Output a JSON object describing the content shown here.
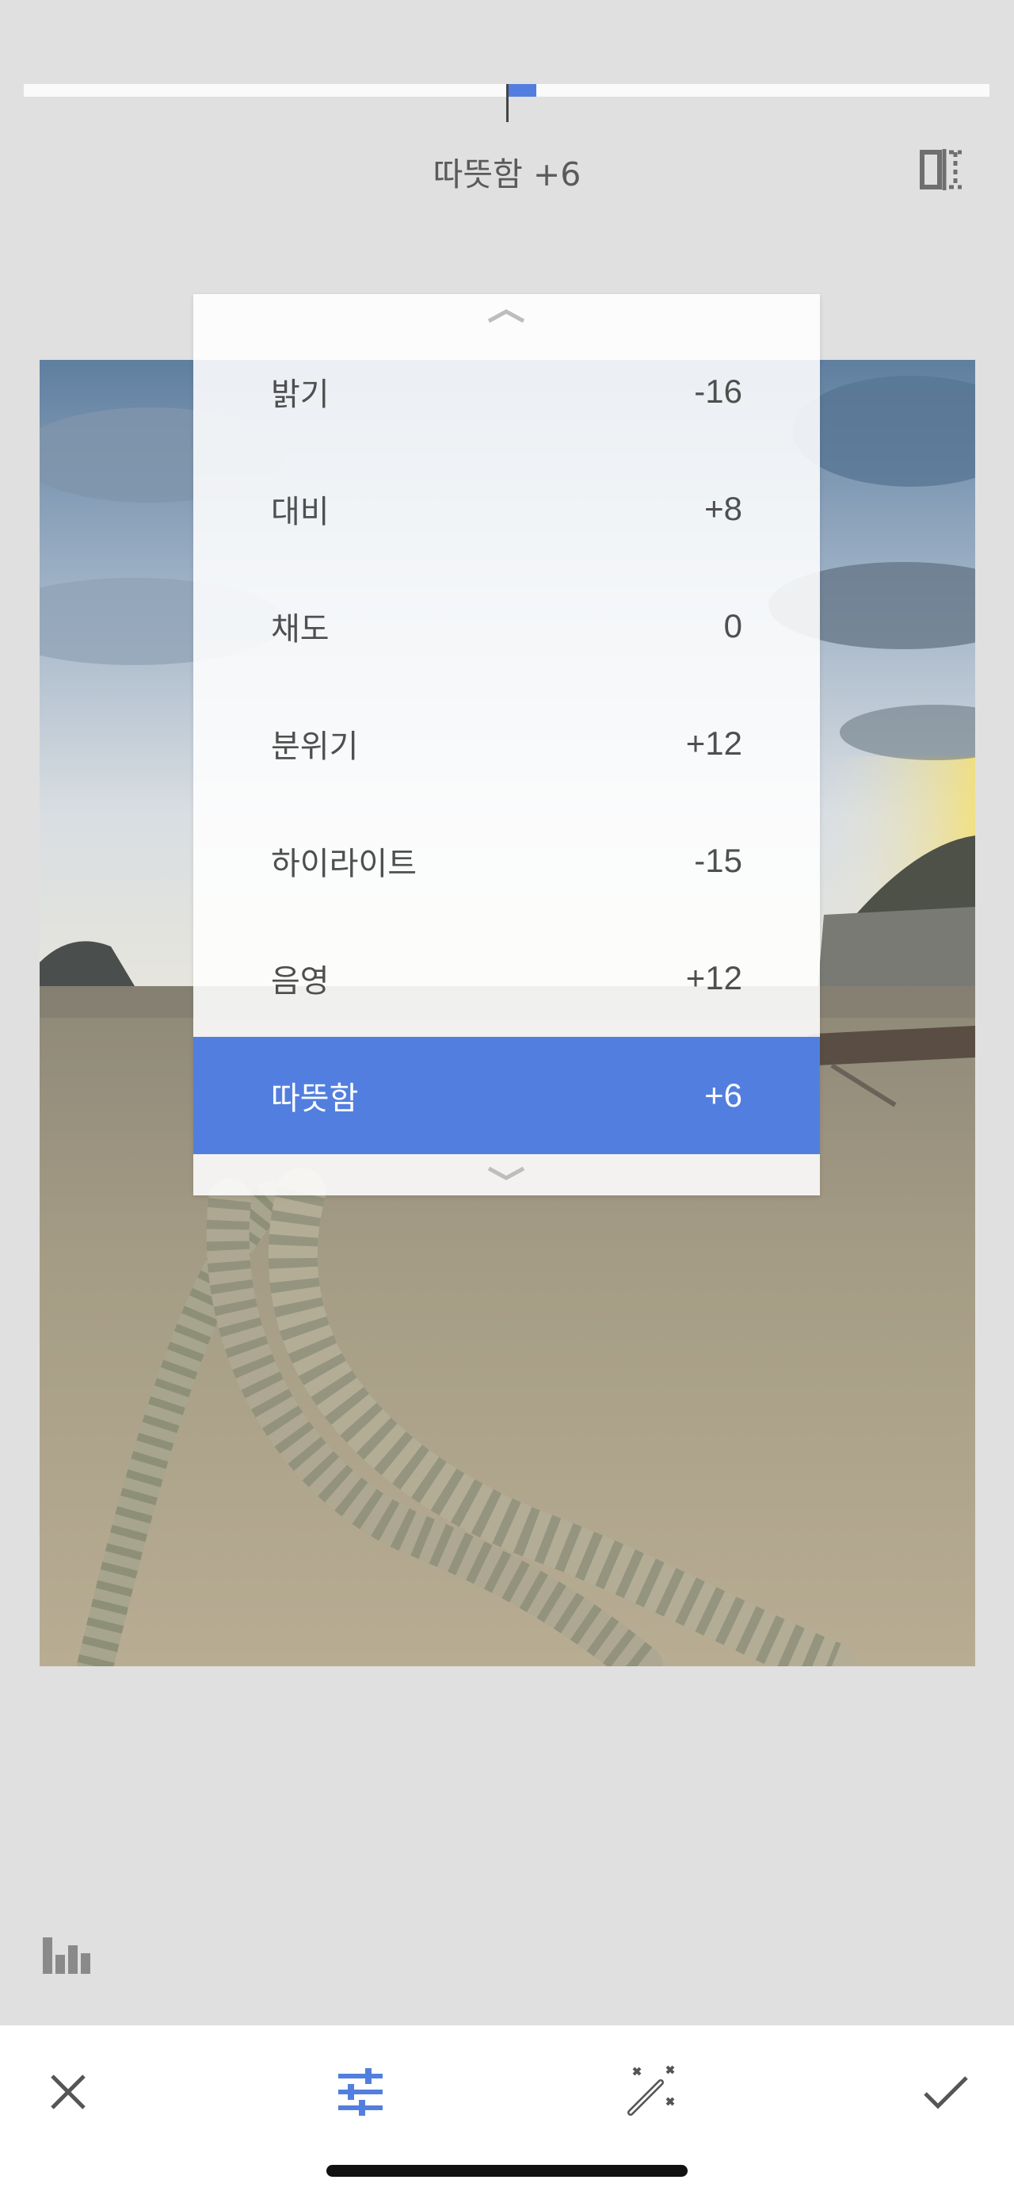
{
  "slider": {
    "value_label": "따뜻함 +6",
    "value": 6,
    "min": -100,
    "max": 100,
    "fill_color": "#527fdf"
  },
  "compare_icon": "compare-split-icon",
  "adjust_menu": {
    "items": [
      {
        "label": "밝기",
        "value": "-16"
      },
      {
        "label": "대비",
        "value": "+8"
      },
      {
        "label": "채도",
        "value": "0"
      },
      {
        "label": "분위기",
        "value": "+12"
      },
      {
        "label": "하이라이트",
        "value": "-15"
      },
      {
        "label": "음영",
        "value": "+12"
      },
      {
        "label": "따뜻함",
        "value": "+6",
        "selected": true
      }
    ],
    "selected_color": "#527fdf"
  },
  "toolbar": {
    "cancel_icon": "close-icon",
    "adjust_icon": "sliders-icon",
    "auto_icon": "magic-wand-icon",
    "apply_icon": "checkmark-icon",
    "active_color": "#527fdf"
  },
  "histogram_icon": "histogram-icon"
}
